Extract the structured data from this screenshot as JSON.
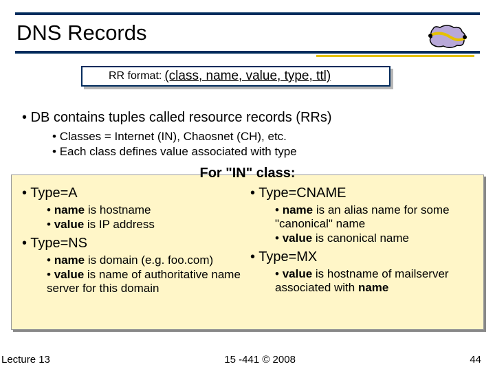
{
  "title": "DNS Records",
  "rr_label": "RR format:",
  "rr_value": "(class, name, value, type, ttl)",
  "main_bullet": "DB contains tuples called resource records (RRs)",
  "sub1": "Classes = Internet (IN), Chaosnet (CH), etc.",
  "sub2": "Each class defines value associated with type",
  "for_in": "For \"IN\" class:",
  "left": {
    "typeA": "Type=A",
    "a1_pre": "name",
    "a1_post": " is hostname",
    "a2_pre": "value",
    "a2_post": " is IP address",
    "typeNS": "Type=NS",
    "ns1_pre": "name",
    "ns1_post": " is domain (e.g. foo.com)",
    "ns2_pre": "value",
    "ns2_post": " is name of authoritative name server for this domain"
  },
  "right": {
    "typeCNAME": "Type=CNAME",
    "c1_pre": "name",
    "c1_post": " is an alias name for some \"canonical\" name",
    "c2_pre": "value",
    "c2_post": " is canonical name",
    "typeMX": "Type=MX",
    "mx1_pre": "value",
    "mx1_post": " is hostname of mailserver associated with ",
    "mx1_end": "name"
  },
  "footer": {
    "left": "Lecture 13",
    "center": "15 -441 ©  2008",
    "right": "44"
  }
}
